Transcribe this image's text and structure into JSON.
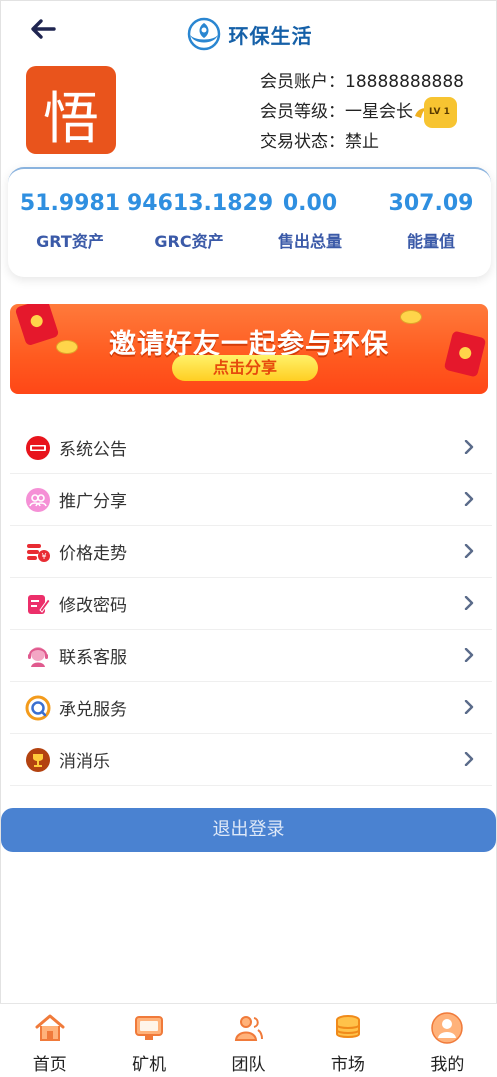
{
  "header": {
    "title": "环保生活",
    "back_icon": "arrow-left-icon",
    "logo_icon": "eco-hands-logo"
  },
  "profile": {
    "avatar_char": "悟",
    "account": "会员账户：18888888888",
    "level": "会员等级：一星会长",
    "level_badge": "LV 1",
    "trade_status": "交易状态：禁止"
  },
  "stats": [
    {
      "value": "51.9981",
      "label": "GRT资产"
    },
    {
      "value": "94613.1829",
      "label": "GRC资产"
    },
    {
      "value": "0.00",
      "label": "售出总量"
    },
    {
      "value": "307.09",
      "label": "能量值"
    }
  ],
  "banner": {
    "title": "邀请好友一起参与环保",
    "button": "点击分享"
  },
  "menu": [
    {
      "label": "系统公告",
      "icon": "notice-icon"
    },
    {
      "label": "推广分享",
      "icon": "share-people-icon"
    },
    {
      "label": "价格走势",
      "icon": "price-trend-icon"
    },
    {
      "label": "修改密码",
      "icon": "edit-password-icon"
    },
    {
      "label": "联系客服",
      "icon": "customer-service-icon"
    },
    {
      "label": "承兑服务",
      "icon": "exchange-service-icon"
    },
    {
      "label": "消消乐",
      "icon": "trophy-icon"
    }
  ],
  "logout": "退出登录",
  "tabs": [
    {
      "label": "首页",
      "icon": "home-icon"
    },
    {
      "label": "矿机",
      "icon": "miner-icon"
    },
    {
      "label": "团队",
      "icon": "team-icon"
    },
    {
      "label": "市场",
      "icon": "market-coins-icon"
    },
    {
      "label": "我的",
      "icon": "profile-icon"
    }
  ],
  "colors": {
    "accent": "#2f8fe0",
    "label_blue": "#3b5aa8",
    "logout_bg": "#4a82d1",
    "banner_orange": "#ff5a1f",
    "brand": "#1560a8"
  }
}
